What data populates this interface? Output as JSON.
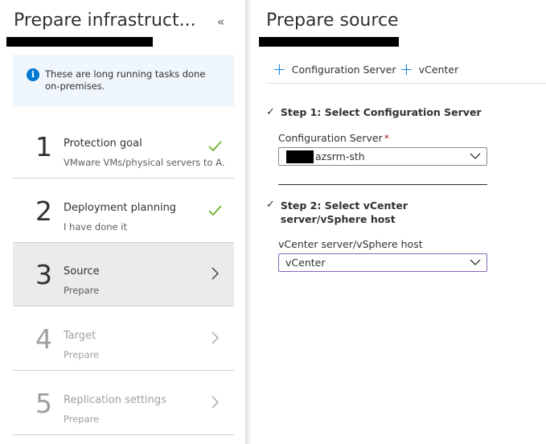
{
  "left_panel": {
    "title": "Prepare infrastruct...",
    "collapse_glyph": "«",
    "info": {
      "icon": "info-icon",
      "text": "These are long running tasks done on-premises."
    },
    "steps": [
      {
        "number": "1",
        "title": "Protection goal",
        "subtitle": "VMware VMs/physical servers to A...",
        "status": "check-icon",
        "state": "done"
      },
      {
        "number": "2",
        "title": "Deployment planning",
        "subtitle": "I have done it",
        "status": "check-icon",
        "state": "done"
      },
      {
        "number": "3",
        "title": "Source",
        "subtitle": "Prepare",
        "status": "chevron-right-icon",
        "state": "active"
      },
      {
        "number": "4",
        "title": "Target",
        "subtitle": "Prepare",
        "status": "chevron-right-icon",
        "state": "disabled"
      },
      {
        "number": "5",
        "title": "Replication settings",
        "subtitle": "Prepare",
        "status": "chevron-right-icon",
        "state": "disabled"
      }
    ]
  },
  "right_panel": {
    "title": "Prepare source",
    "toolbar": [
      {
        "label": "Configuration Server",
        "icon": "plus-icon"
      },
      {
        "label": "vCenter",
        "icon": "plus-icon"
      }
    ],
    "step1": {
      "heading": "Step 1: Select Configuration Server",
      "field_label": "Configuration Server",
      "required_mark": "*",
      "value": "azsrm-sth"
    },
    "step2": {
      "heading": "Step 2: Select vCenter server/vSphere host",
      "field_label": "vCenter server/vSphere host",
      "value": "vCenter"
    }
  },
  "colors": {
    "accent": "#0078d4",
    "check": "#57a300",
    "active_row": "#ebebeb",
    "info_bg": "#eff6fc",
    "required": "#a4262c"
  }
}
